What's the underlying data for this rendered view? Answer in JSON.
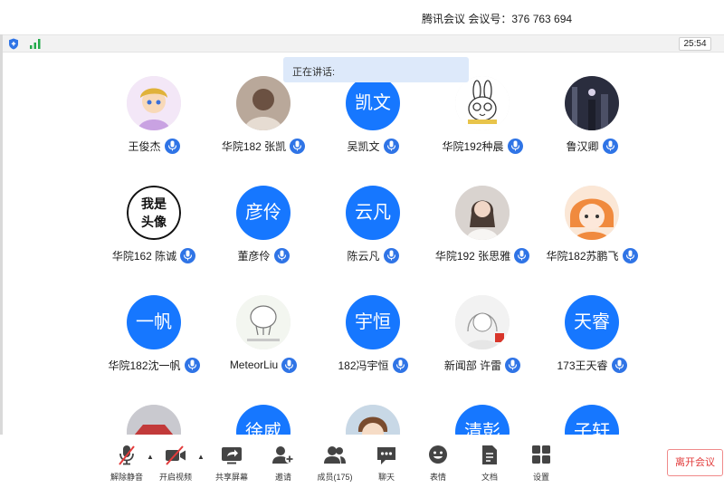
{
  "window": {
    "title": "腾讯会议 会议号：376 763 694"
  },
  "status": {
    "timer": "25:54"
  },
  "speaking": {
    "label": "正在讲话:"
  },
  "participants": [
    {
      "name": "王俊杰",
      "avatar_type": "image",
      "avatar_desc": "cartoon-avatar-icon"
    },
    {
      "name": "华院182 张凯",
      "avatar_type": "image",
      "avatar_desc": "photo-avatar-icon"
    },
    {
      "name": "吴凯文",
      "avatar_type": "text",
      "avatar_text": "凯文"
    },
    {
      "name": "华院192种晨",
      "avatar_type": "image",
      "avatar_desc": "rabbit-avatar-icon"
    },
    {
      "name": "鲁汉卿",
      "avatar_type": "image",
      "avatar_desc": "night-photo-avatar-icon"
    },
    {
      "name": "华院162 陈诚",
      "avatar_type": "image",
      "avatar_desc": "text-avatar-icon",
      "avatar_art_text": "我是头像"
    },
    {
      "name": "董彦伶",
      "avatar_type": "text",
      "avatar_text": "彦伶"
    },
    {
      "name": "陈云凡",
      "avatar_type": "text",
      "avatar_text": "云凡"
    },
    {
      "name": "华院192 张思雅",
      "avatar_type": "image",
      "avatar_desc": "portrait-avatar-icon"
    },
    {
      "name": "华院182苏鹏飞",
      "avatar_type": "image",
      "avatar_desc": "anime-avatar-icon"
    },
    {
      "name": "华院182沈一帆",
      "avatar_type": "text",
      "avatar_text": "一帆"
    },
    {
      "name": "MeteorLiu",
      "avatar_type": "image",
      "avatar_desc": "sketch-avatar-icon"
    },
    {
      "name": "182冯宇恒",
      "avatar_type": "text",
      "avatar_text": "宇恒"
    },
    {
      "name": "新闻部 许雷",
      "avatar_type": "image",
      "avatar_desc": "drawing-avatar-icon"
    },
    {
      "name": "173王天睿",
      "avatar_type": "text",
      "avatar_text": "天睿"
    },
    {
      "name": "",
      "avatar_type": "image",
      "avatar_desc": "car-avatar-icon"
    },
    {
      "name": "",
      "avatar_type": "text",
      "avatar_text": "徐威"
    },
    {
      "name": "",
      "avatar_type": "image",
      "avatar_desc": "boy-avatar-icon"
    },
    {
      "name": "",
      "avatar_type": "text",
      "avatar_text": "清彭"
    },
    {
      "name": "",
      "avatar_type": "text",
      "avatar_text": "子轩"
    }
  ],
  "toolbar": {
    "unmute": "解除静音",
    "video": "开启视频",
    "share": "共享屏幕",
    "invite": "邀请",
    "members": "成员(175)",
    "chat": "聊天",
    "emoji": "表情",
    "docs": "文档",
    "settings": "设置",
    "leave": "离开会议"
  },
  "colors": {
    "accent": "#1677ff",
    "leave": "#e23b3b",
    "mute": "#e23b3b"
  }
}
